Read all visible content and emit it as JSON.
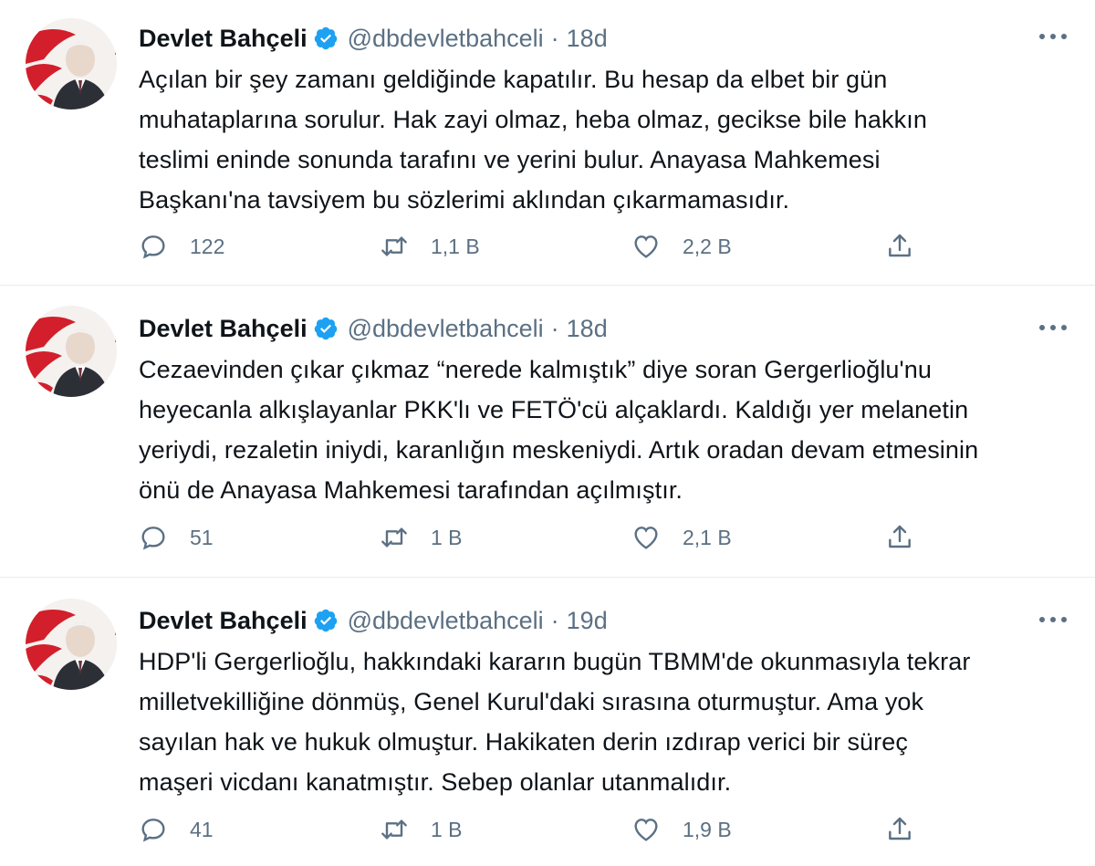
{
  "colors": {
    "text": "#0f1419",
    "secondary": "#5b7083",
    "verified": "#1da1f2",
    "divider": "#e6ecf0"
  },
  "tweets": [
    {
      "name": "Devlet Bahçeli",
      "handle": "@dbdevletbahceli",
      "separator": "·",
      "time": "18d",
      "text": "Açılan bir şey zamanı geldiğinde kapatılır. Bu hesap da elbet bir gün\nmuhataplarına sorulur. Hak zayi olmaz, heba olmaz, gecikse bile hakkın\nteslimi eninde sonunda tarafını ve yerini bulur. Anayasa Mahkemesi\nBaşkanı'na tavsiyem bu sözlerimi aklından çıkarmamasıdır.",
      "replies": "122",
      "retweets": "1,1 B",
      "likes": "2,2 B"
    },
    {
      "name": "Devlet Bahçeli",
      "handle": "@dbdevletbahceli",
      "separator": "·",
      "time": "18d",
      "text": "Cezaevinden çıkar çıkmaz “nerede kalmıştık” diye soran Gergerlioğlu'nu\nheyecanla alkışlayanlar PKK'lı ve FETÖ'cü alçaklardı. Kaldığı yer melanetin\nyeriydi, rezaletin iniydi, karanlığın meskeniydi. Artık oradan devam etmesinin\nönü de Anayasa Mahkemesi tarafından açılmıştır.",
      "replies": "51",
      "retweets": "1 B",
      "likes": "2,1 B"
    },
    {
      "name": "Devlet Bahçeli",
      "handle": "@dbdevletbahceli",
      "separator": "·",
      "time": "19d",
      "text": "HDP'li Gergerlioğlu, hakkındaki kararın bugün TBMM'de okunmasıyla tekrar\nmilletvekilliğine dönmüş, Genel Kurul'daki sırasına oturmuştur. Ama yok\nsayılan hak ve hukuk olmuştur. Hakikaten derin ızdırap verici bir süreç\nmaşeri vicdanı kanatmıştır. Sebep olanlar utanmalıdır.",
      "replies": "41",
      "retweets": "1 B",
      "likes": "1,9 B"
    }
  ]
}
